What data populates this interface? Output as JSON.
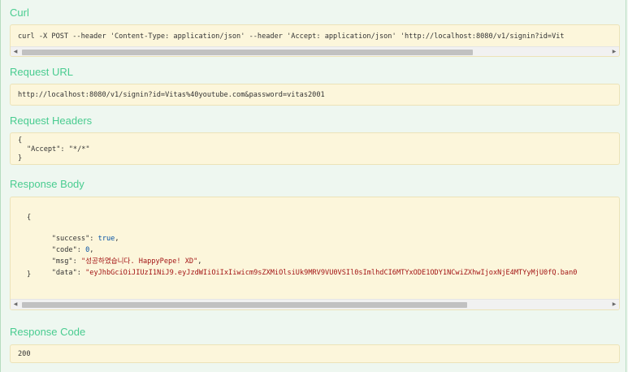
{
  "curl": {
    "heading": "Curl",
    "command": "curl -X POST --header 'Content-Type: application/json' --header 'Accept: application/json' 'http://localhost:8080/v1/signin?id=Vit"
  },
  "request_url": {
    "heading": "Request URL",
    "value": "http://localhost:8080/v1/signin?id=Vitas%40youtube.com&password=vitas2001"
  },
  "request_headers": {
    "heading": "Request Headers",
    "open": "{",
    "line": "\"Accept\": \"*/*\"",
    "close": "}"
  },
  "response_body": {
    "heading": "Response Body",
    "open": "{",
    "close": "}",
    "fields": [
      {
        "key": "\"success\"",
        "value": "true"
      },
      {
        "key": "\"code\"",
        "value": "0"
      },
      {
        "key": "\"msg\"",
        "value": "\"성공하였습니다. HappyPepe! XD\""
      },
      {
        "key": "\"data\"",
        "value": "\"eyJhbGciOiJIUzI1NiJ9.eyJzdWIiOiIxIiwicm9sZXMiOlsiUk9MRV9VU0VSIl0sImlhdCI6MTYxODE1ODY1NCwiZXhwIjoxNjE4MTYyMjU0fQ.ban0"
      }
    ]
  },
  "response_code": {
    "heading": "Response Code",
    "value": "200"
  },
  "scroll": {
    "left_arrow": "◀",
    "right_arrow": "▶",
    "curl_thumb_fraction": 0.77,
    "body_thumb_fraction": 0.76
  }
}
